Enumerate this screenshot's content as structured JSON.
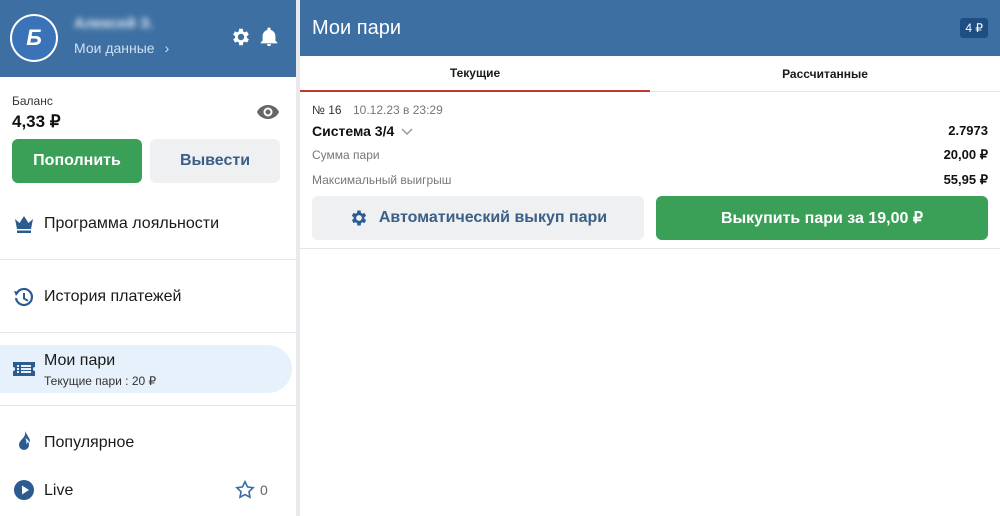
{
  "colors": {
    "header_bg": "#3d6fa3",
    "accent_green": "#3aa058",
    "secondary_button_bg": "#eef0f2",
    "secondary_button_text": "#3b5f86",
    "active_nav_bg": "#e6f1fb",
    "active_tab_underline": "#c0392b",
    "icon_blue": "#2c5c8f"
  },
  "sidebar": {
    "avatar_letter": "Б",
    "user_name": "Алексей З.",
    "my_data_label": "Мои данные",
    "chevron_right": "›",
    "icons": [
      "gear-icon",
      "bell-icon",
      "eye-icon"
    ],
    "balance": {
      "label": "Баланс",
      "value": "4,33 ₽"
    },
    "buttons": {
      "topup": "Пополнить",
      "withdraw": "Вывести"
    },
    "nav": {
      "loyalty": {
        "label": "Программа лояльности",
        "icon": "crown-icon"
      },
      "payments": {
        "label": "История платежей",
        "icon": "history-icon"
      },
      "my_bets": {
        "label": "Мои пари",
        "sub": "Текущие пари : 20 ₽",
        "icon": "ticket-icon",
        "active": true
      },
      "popular": {
        "label": "Популярное",
        "icon": "flame-icon"
      },
      "live": {
        "label": "Live",
        "icon": "play-icon",
        "favorites_count": "0"
      }
    }
  },
  "main": {
    "title": "Мои пари",
    "count_badge": "4 ₽",
    "tabs": {
      "current": "Текущие",
      "settled": "Рассчитанные"
    },
    "bet": {
      "number": "№ 16",
      "date": "10.12.23 в 23:29",
      "type": "Система 3/4",
      "odds": "2.7973",
      "stake_label": "Сумма пари",
      "stake_value": "20,00 ₽",
      "max_win_label": "Максимальный выигрыш",
      "max_win_value": "55,95 ₽",
      "auto_cashout_label": "Автоматический выкуп пари",
      "cashout_label": "Выкупить пари за 19,00 ₽"
    }
  }
}
